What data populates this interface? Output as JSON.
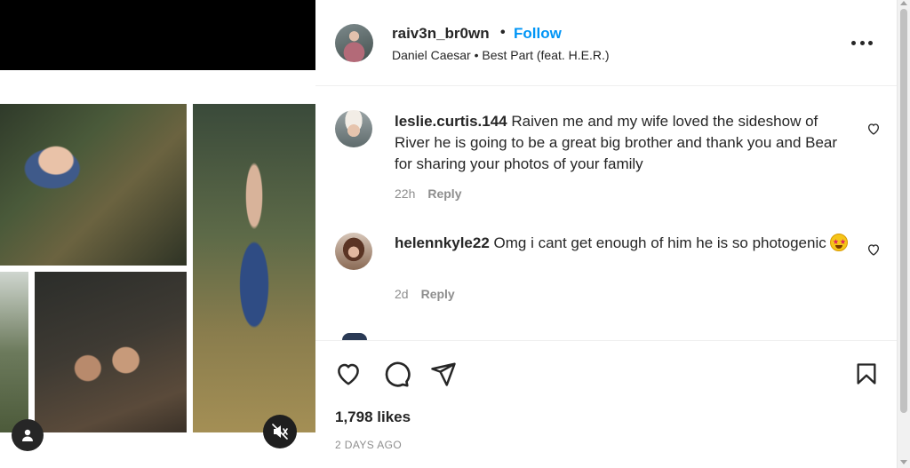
{
  "post": {
    "username": "raiv3n_br0wn",
    "separator": "•",
    "follow_label": "Follow",
    "song": "Daniel Caesar • Best Part (feat. H.E.R.)",
    "more_icon": "more-horizontal-icon"
  },
  "media": {
    "user_tag_icon": "user-tag-icon",
    "mute_icon": "volume-muted-icon"
  },
  "comments": [
    {
      "user": "leslie.curtis.144",
      "text": "Raiven me and my wife loved the sideshow of River he is going to be a great big brother and thank you and Bear for sharing your photos of your family",
      "age": "22h",
      "reply_label": "Reply"
    },
    {
      "user": "helennkyle22",
      "text": "Omg i cant get enough of him he is so photogenic",
      "emoji": "star-struck-emoji",
      "age": "2d",
      "reply_label": "Reply"
    }
  ],
  "actions": {
    "icons": [
      "like-icon",
      "comment-icon",
      "share-icon",
      "save-icon"
    ],
    "likes": "1,798 likes",
    "posted": "2 DAYS AGO"
  },
  "colors": {
    "accent": "#0095f6",
    "text": "#262626",
    "muted": "#8e8e8e"
  }
}
